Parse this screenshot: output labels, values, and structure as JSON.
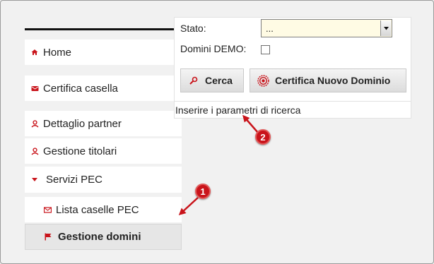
{
  "sidebar": {
    "items": [
      {
        "label": "Home",
        "icon": "home-icon"
      },
      {
        "label": "Certifica casella",
        "icon": "envelope-icon"
      },
      {
        "label": "Dettaglio partner",
        "icon": "user-icon"
      },
      {
        "label": "Gestione titolari",
        "icon": "user-icon"
      },
      {
        "label": "Servizi PEC",
        "icon": "caret-down-icon",
        "expanded": true
      },
      {
        "label": "Lista caselle PEC",
        "icon": "envelope-icon"
      },
      {
        "label": "Gestione  domini",
        "icon": "flag-icon",
        "active": true
      }
    ]
  },
  "search": {
    "stato_label": "Stato:",
    "stato_value": "...",
    "demo_label": "Domini DEMO:",
    "demo_checked": false,
    "cerca_label": "Cerca",
    "certifica_label": "Certifica Nuovo Dominio",
    "hint": "Inserire i parametri di ricerca"
  },
  "annotations": {
    "callout_1": "1",
    "callout_2": "2"
  },
  "colors": {
    "accent_red": "#c9141b",
    "select_bg": "#fffbe4",
    "active_bg": "#e6e6e6"
  }
}
